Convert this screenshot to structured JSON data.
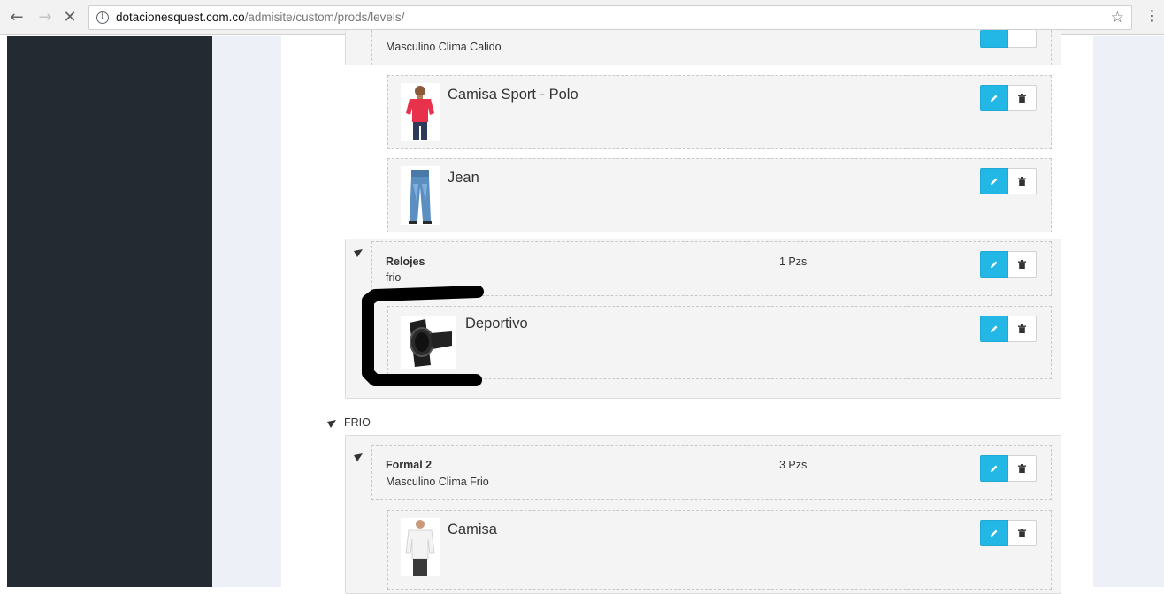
{
  "browser": {
    "url_host": "dotacionesquest.com.co",
    "url_path": "/admisite/custom/prods/levels/"
  },
  "tree": {
    "top_partial": {
      "subtitle": "Masculino Clima Calido"
    },
    "products_a": [
      {
        "name": "Camisa Sport - Polo"
      },
      {
        "name": "Jean"
      }
    ],
    "relojes": {
      "title": "Relojes",
      "qty": "1 Pzs",
      "subtitle": "frio"
    },
    "products_b": [
      {
        "name": "Deportivo"
      }
    ],
    "group_frio": {
      "label": "FRIO"
    },
    "formal2": {
      "title": "Formal 2",
      "qty": "3 Pzs",
      "subtitle": "Masculino Clima Frio"
    },
    "products_c": [
      {
        "name": "Camisa"
      }
    ]
  },
  "icons": {
    "edit": "pencil-icon",
    "delete": "trash-icon",
    "expand": "caret-down-icon"
  },
  "colors": {
    "edit_button": "#23b7e5",
    "sidebar": "#232a31",
    "page_background": "#edf0f6"
  }
}
